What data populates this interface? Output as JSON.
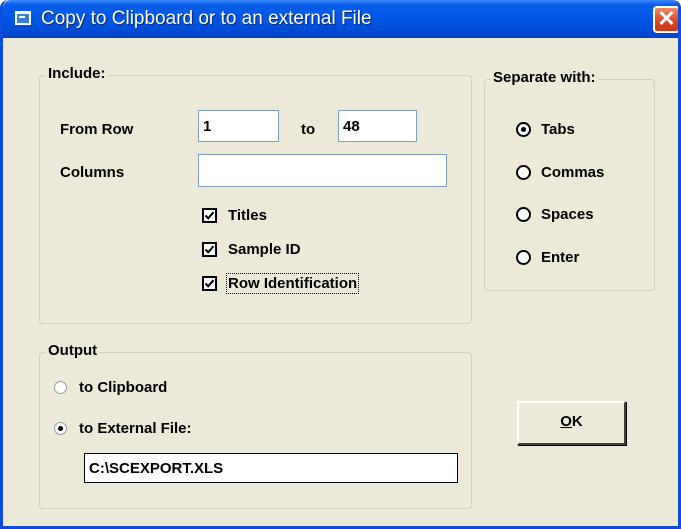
{
  "window": {
    "title": "Copy to Clipboard or to an external File",
    "close_label": "✕"
  },
  "include": {
    "legend": "Include:",
    "from_row_label": "From Row",
    "from_row_value": "1",
    "to_label": "to",
    "to_value": "48",
    "columns_label": "Columns",
    "columns_value": "",
    "checkboxes": [
      {
        "label": "Titles",
        "checked": true
      },
      {
        "label": "Sample ID",
        "checked": true
      },
      {
        "label": "Row Identification",
        "checked": true
      }
    ]
  },
  "separate": {
    "legend": "Separate with:",
    "options": [
      {
        "label": "Tabs",
        "selected": true
      },
      {
        "label": "Commas",
        "selected": false
      },
      {
        "label": "Spaces",
        "selected": false
      },
      {
        "label": "Enter",
        "selected": false
      }
    ]
  },
  "output": {
    "legend": "Output",
    "options": [
      {
        "label": "to Clipboard",
        "selected": false
      },
      {
        "label": "to External File:",
        "selected": true
      }
    ],
    "file_path": "C:\\SCEXPORT.XLS"
  },
  "ok": {
    "accel": "O",
    "rest": "K"
  },
  "colors": {
    "titlebar": "#0055e5",
    "window_bg": "#ece9d8",
    "close_button": "#d9431e"
  }
}
